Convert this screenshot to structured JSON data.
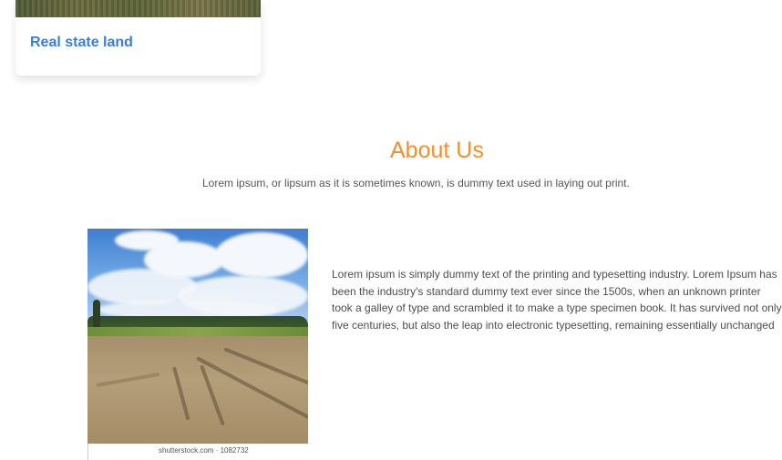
{
  "card": {
    "title": "Real state land"
  },
  "about": {
    "title": "About Us",
    "subtitle": "Lorem ipsum, or lipsum as it is sometimes known, is dummy text used in laying out print.",
    "body": "Lorem ipsum is simply dummy text of the printing and typesetting industry. Lorem Ipsum has been the industry's standard dummy text ever since the 1500s, when an unknown printer took a galley of type and scrambled it to make a type specimen book. It has survived not only five centuries, but also the leap into electronic typesetting, remaining essentially unchanged",
    "image_caption": "shutterstock.com · 1082732"
  },
  "colors": {
    "accent": "#f0902e",
    "link": "#3b7dd8"
  }
}
